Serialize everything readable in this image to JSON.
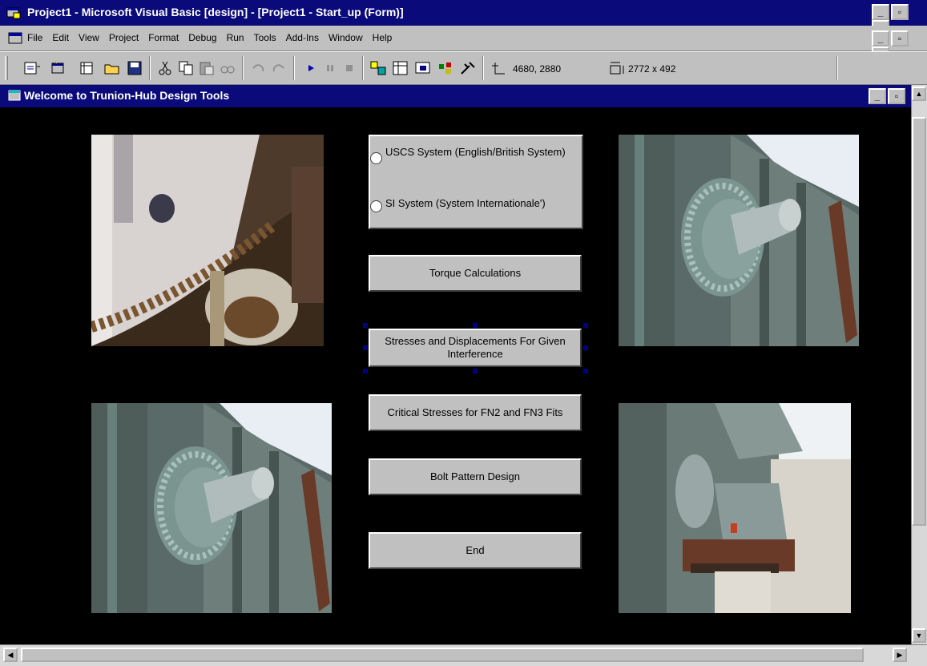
{
  "app": {
    "title": "Project1 - Microsoft Visual Basic [design] - [Project1 - Start_up (Form)]",
    "window_buttons": [
      "_",
      "▫",
      "×"
    ]
  },
  "menu": {
    "items": [
      "File",
      "Edit",
      "View",
      "Project",
      "Format",
      "Debug",
      "Run",
      "Tools",
      "Add-Ins",
      "Window",
      "Help"
    ]
  },
  "toolbar": {
    "position_readout": "4680, 2880",
    "size_readout": "2772 x 492",
    "icons": [
      "add-project-icon",
      "add-form-icon",
      "menu-editor-icon",
      "open-icon",
      "save-icon",
      "cut-icon",
      "copy-icon",
      "paste-icon",
      "find-icon",
      "undo-icon",
      "redo-icon",
      "start-icon",
      "break-icon",
      "end-icon",
      "project-explorer-icon",
      "properties-icon",
      "form-layout-icon",
      "object-browser-icon",
      "toolbox-icon"
    ]
  },
  "form": {
    "title": "Welcome to Trunion-Hub Design Tools",
    "options": {
      "uscs": "USCS System (English/British System)",
      "si": "SI System (System Internationale')"
    },
    "buttons": {
      "torque": "Torque Calculations",
      "stresses": "Stresses and Displacements For Given Interference",
      "critical": "Critical Stresses for FN2 and FN3 Fits",
      "bolt": "Bolt Pattern Design",
      "end": "End"
    }
  },
  "colors": {
    "titlebar": "#0a0a7a",
    "form_background": "#000000",
    "button_face": "#c0c0c0"
  }
}
